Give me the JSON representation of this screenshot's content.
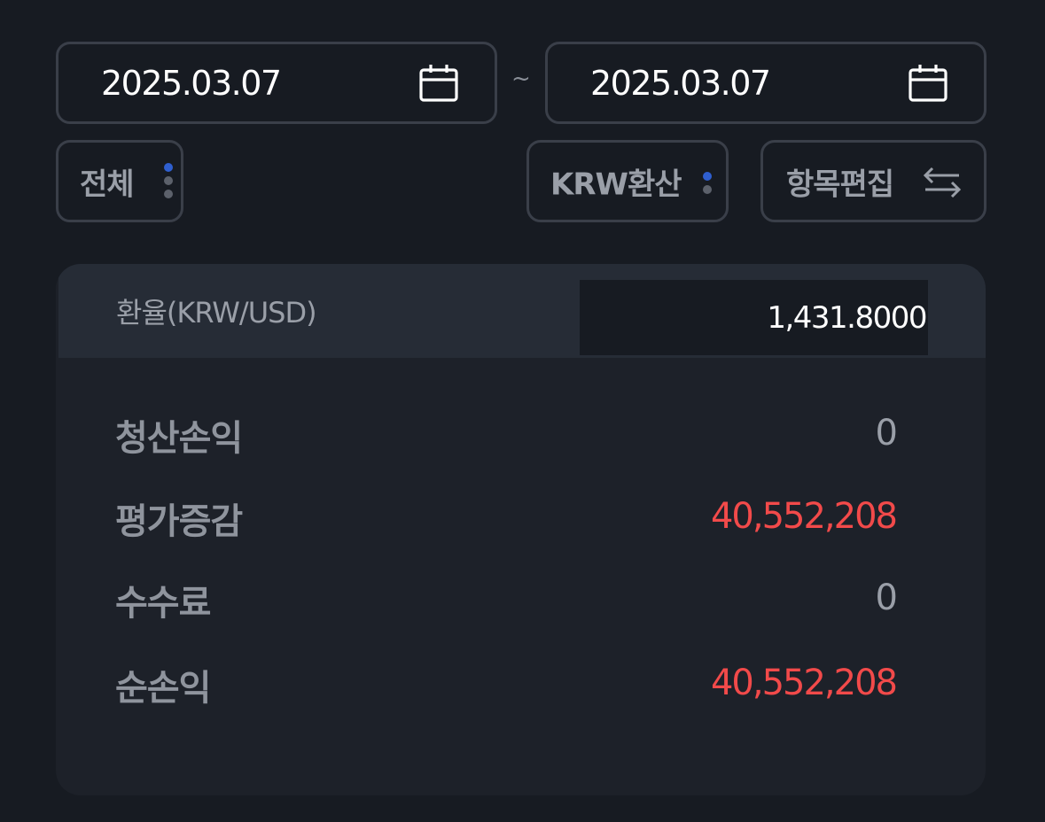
{
  "date_range": {
    "start": "2025.03.07",
    "separator": "~",
    "end": "2025.03.07",
    "icon": "calendar-icon"
  },
  "filters": {
    "all_label": "전체",
    "krw_label": "KRW환산",
    "edit_label": "항목편집",
    "edit_icon": "swap-arrows-icon",
    "menu_icon": "vertical-dots-icon"
  },
  "summary": {
    "rate_label": "환율(KRW/USD)",
    "rate_value": "1,431.8000",
    "rows": [
      {
        "label": "청산손익",
        "value": "0"
      },
      {
        "label": "평가증감",
        "value": "40,552,208"
      },
      {
        "label": "수수료",
        "value": "0"
      },
      {
        "label": "순손익",
        "value": "40,552,208"
      }
    ]
  },
  "colors": {
    "background": "#171b22",
    "panel": "#1d2129",
    "panel_header": "#262c36",
    "border": "#3a3f49",
    "positive_red": "#f24a4a",
    "accent_blue": "#2f5fd0"
  }
}
